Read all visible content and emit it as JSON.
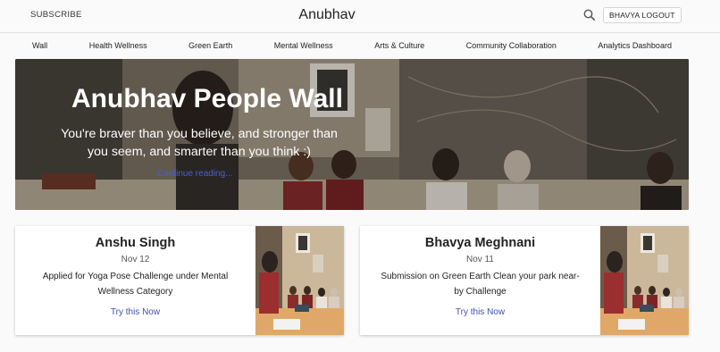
{
  "header": {
    "subscribe_label": "SUBSCRIBE",
    "brand": "Anubhav",
    "search_icon": "search-icon",
    "logout_label": "BHAVYA LOGOUT"
  },
  "nav": {
    "items": [
      "Wall",
      "Health Wellness",
      "Green Earth",
      "Mental Wellness",
      "Arts & Culture",
      "Community Collaboration",
      "Analytics Dashboard"
    ]
  },
  "hero": {
    "title": "Anubhav People Wall",
    "subtitle": "You're braver than you believe, and stronger than you seem, and smarter than you think :)",
    "link_label": "Continue reading..."
  },
  "cards": [
    {
      "name": "Anshu Singh",
      "date": "Nov 12",
      "description": "Applied for Yoga Pose Challenge under Mental Wellness Category",
      "cta": "Try this Now"
    },
    {
      "name": "Bhavya Meghnani",
      "date": "Nov 11",
      "description": "Submission on Green Earth Clean your park near-by Challenge",
      "cta": "Try this Now"
    }
  ],
  "colors": {
    "link": "#3f51b5",
    "background": "#fafafa"
  }
}
